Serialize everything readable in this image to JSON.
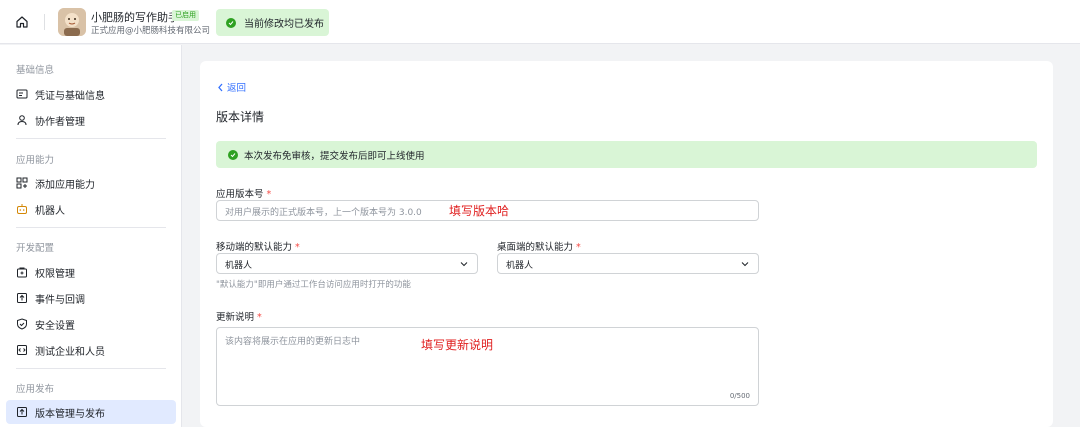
{
  "header": {
    "app_name": "小肥肠的写作助手",
    "status_badge": "已启用",
    "app_subtitle": "正式应用@小肥肠科技有限公司",
    "publish_status": "当前修改均已发布"
  },
  "sidebar": {
    "sections": [
      {
        "title": "基础信息",
        "items": [
          {
            "label": "凭证与基础信息",
            "icon": "credential-icon"
          },
          {
            "label": "协作者管理",
            "icon": "user-icon"
          }
        ]
      },
      {
        "title": "应用能力",
        "items": [
          {
            "label": "添加应用能力",
            "icon": "add-apps-icon"
          },
          {
            "label": "机器人",
            "icon": "robot-icon"
          }
        ]
      },
      {
        "title": "开发配置",
        "items": [
          {
            "label": "权限管理",
            "icon": "permission-icon"
          },
          {
            "label": "事件与回调",
            "icon": "event-icon"
          },
          {
            "label": "安全设置",
            "icon": "shield-icon"
          },
          {
            "label": "测试企业和人员",
            "icon": "test-icon"
          }
        ]
      },
      {
        "title": "应用发布",
        "items": [
          {
            "label": "版本管理与发布",
            "icon": "upload-icon",
            "active": true
          }
        ]
      }
    ]
  },
  "main": {
    "back_label": "返回",
    "page_title": "版本详情",
    "notice": "本次发布免审核，提交发布后即可上线使用",
    "version": {
      "label": "应用版本号",
      "required_mark": "*",
      "placeholder": "对用户展示的正式版本号，上一个版本号为 3.0.0",
      "annotation": "填写版本哈"
    },
    "mobile_default": {
      "label": "移动端的默认能力",
      "required_mark": "*",
      "value": "机器人"
    },
    "desktop_default": {
      "label": "桌面端的默认能力",
      "required_mark": "*",
      "value": "机器人"
    },
    "default_hint": "\"默认能力\"即用户通过工作台访问应用时打开的功能",
    "update_notes": {
      "label": "更新说明",
      "required_mark": "*",
      "placeholder": "该内容将展示在应用的更新日志中",
      "annotation": "填写更新说明",
      "counter": "0/500"
    }
  },
  "colors": {
    "accent": "#3370ff",
    "success": "#2ea121",
    "success_bg": "#d9f5d6",
    "required": "#f54a45",
    "annotation": "#e02020"
  }
}
